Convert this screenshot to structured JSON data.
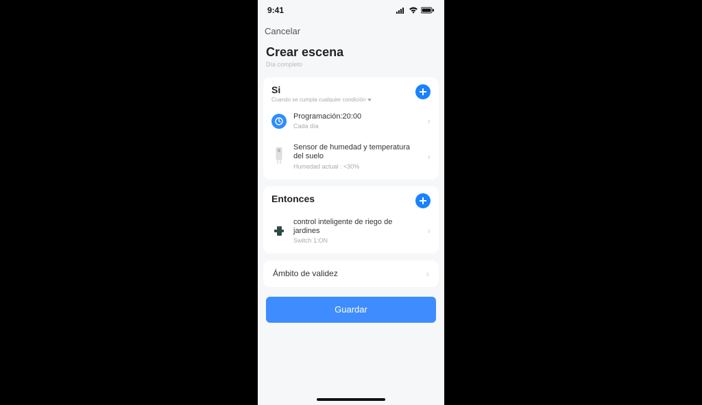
{
  "status": {
    "time": "9:41"
  },
  "nav": {
    "cancel": "Cancelar"
  },
  "header": {
    "title": "Crear escena",
    "subtitle": "Día completo"
  },
  "if_section": {
    "title": "Si",
    "subtitle": "Cuando se cumpla cualquier condición",
    "items": [
      {
        "title": "Programación:20:00",
        "subtitle": "Cada día",
        "icon": "clock"
      },
      {
        "title": "Sensor de humedad y temperatura del suelo",
        "subtitle": "Humedad actual : <30%",
        "icon": "moisture-sensor"
      }
    ]
  },
  "then_section": {
    "title": "Entonces",
    "items": [
      {
        "title": "control inteligente de riego de jardines",
        "subtitle": "Switch 1:ON",
        "icon": "irrigation-controller"
      }
    ]
  },
  "validity": {
    "label": "Ámbito de validez"
  },
  "save": {
    "label": "Guardar"
  }
}
